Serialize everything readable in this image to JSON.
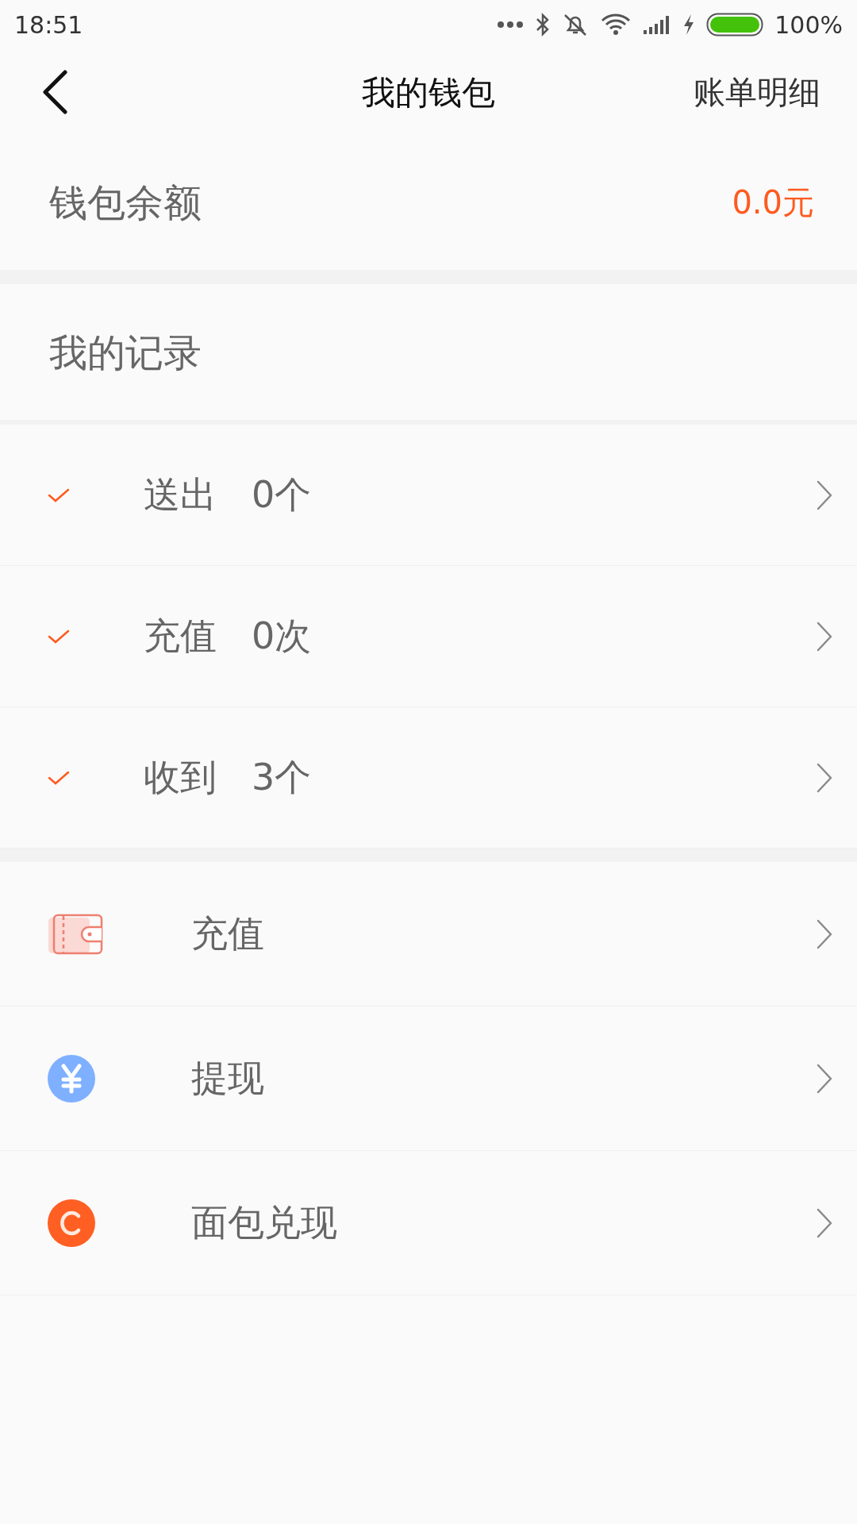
{
  "status_bar": {
    "time": "18:51",
    "battery": "100%"
  },
  "header": {
    "title": "我的钱包",
    "action": "账单明细"
  },
  "balance": {
    "label": "钱包余额",
    "value": "0.0元"
  },
  "records": {
    "title": "我的记录",
    "items": [
      {
        "label": "送出",
        "value": "0个"
      },
      {
        "label": "充值",
        "value": "0次"
      },
      {
        "label": "收到",
        "value": "3个"
      }
    ]
  },
  "actions": [
    {
      "label": "充值",
      "kind": "wallet"
    },
    {
      "label": "提现",
      "kind": "yen"
    },
    {
      "label": "面包兑现",
      "kind": "coin"
    }
  ]
}
